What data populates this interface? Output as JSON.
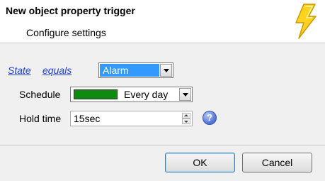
{
  "header": {
    "title": "New object property trigger",
    "subtitle": "Configure settings",
    "icon": "lightning-bolt-icon"
  },
  "condition": {
    "property_link": "State",
    "operator_link": "equals",
    "value_selected": "Alarm"
  },
  "schedule": {
    "label": "Schedule",
    "selected": "Every day",
    "swatch_color": "#0e8a0e"
  },
  "hold_time": {
    "label": "Hold time",
    "value": "15sec",
    "help_glyph": "?"
  },
  "buttons": {
    "ok": "OK",
    "cancel": "Cancel"
  }
}
